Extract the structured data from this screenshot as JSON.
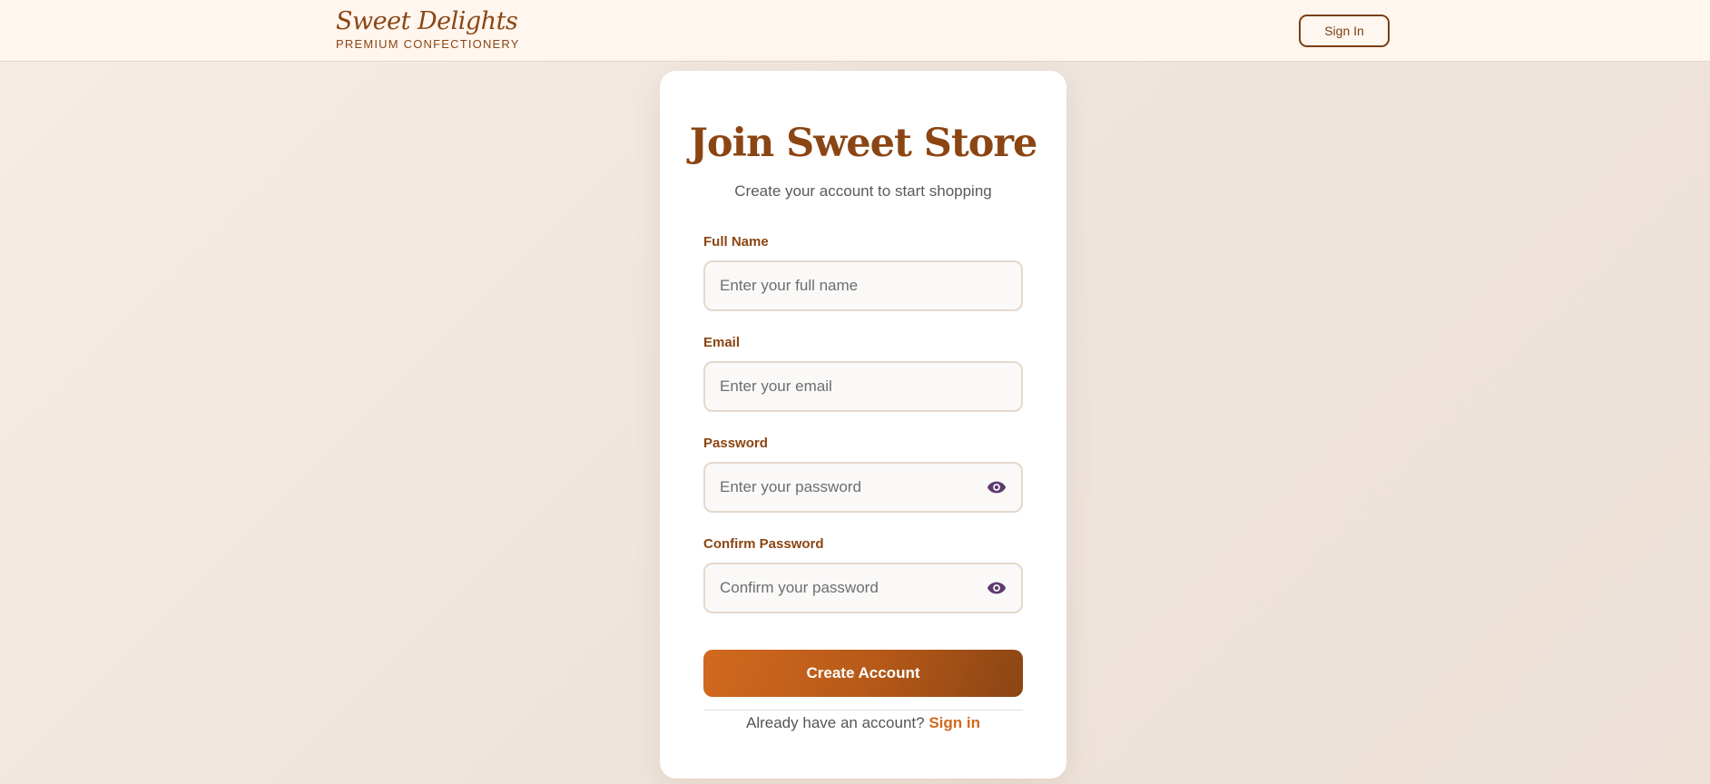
{
  "header": {
    "brand_name": "Sweet Delights",
    "brand_tagline": "PREMIUM CONFECTIONERY",
    "signin_label": "Sign In"
  },
  "form": {
    "title": "Join Sweet Store",
    "subtitle": "Create your account to start shopping",
    "full_name": {
      "label": "Full Name",
      "placeholder": "Enter your full name",
      "value": ""
    },
    "email": {
      "label": "Email",
      "placeholder": "Enter your email",
      "value": ""
    },
    "password": {
      "label": "Password",
      "placeholder": "Enter your password",
      "value": "",
      "toggle_icon": "eye-icon"
    },
    "confirm_password": {
      "label": "Confirm Password",
      "placeholder": "Confirm your password",
      "value": "",
      "toggle_icon": "eye-icon"
    },
    "submit_label": "Create Account",
    "footer_prompt": "Already have an account?",
    "footer_link": "Sign in"
  },
  "colors": {
    "brand": "#8b4513",
    "accent": "#d2691e",
    "eye_icon": "#5c3a6e"
  }
}
